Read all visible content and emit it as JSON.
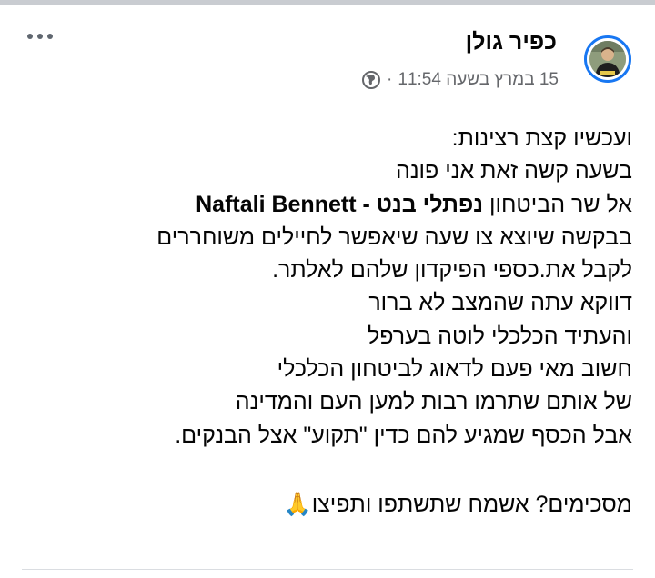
{
  "post": {
    "author": "כפיר גולן",
    "timestamp": "15 במרץ בשעה 11:54",
    "separator": "·",
    "privacy_icon": "globe-icon",
    "more_icon": "more-options-icon",
    "lines": [
      "ועכשיו קצת רצינות:",
      "בשעה קשה זאת אני פונה"
    ],
    "mention_line": {
      "prefix": "אל שר הביטחון ",
      "mention": "נפתלי בנט - Naftali Bennett"
    },
    "lines_after": [
      "בבקשה שיוצא צו שעה שיאפשר לחיילים משוחררים",
      "לקבל את.כספי הפיקדון שלהם לאלתר.",
      "דווקא עתה שהמצב לא ברור",
      "והעתיד הכלכלי לוטה בערפל",
      "חשוב מאי פעם לדאוג לביטחון הכלכלי",
      "של אותם שתרמו רבות למען העם והמדינה",
      "אבל הכסף שמגיע להם כדין \"תקוע\" אצל הבנקים."
    ],
    "closing": "מסכימים? אשמח שתשתפו ותפיצו🙏"
  },
  "colors": {
    "accent": "#1877f2",
    "meta_text": "#65676b",
    "body_text": "#050505"
  }
}
